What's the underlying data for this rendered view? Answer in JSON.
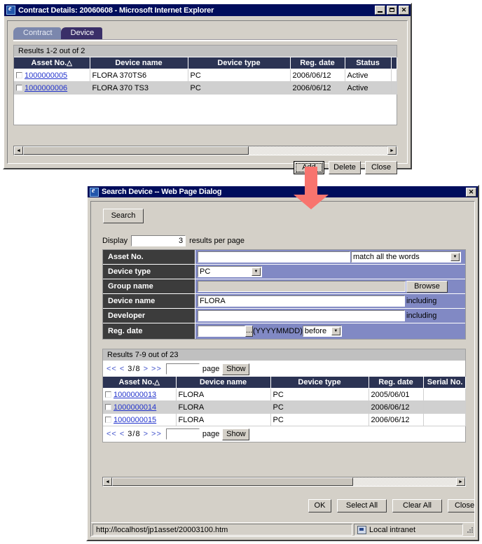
{
  "window1": {
    "title": "Contract Details: 20060608 - Microsoft Internet Explorer",
    "minimize_label": "_",
    "maximize_label": "□",
    "close_label": "×",
    "tabs": [
      {
        "label": "Contract",
        "active": false
      },
      {
        "label": "Device",
        "active": true
      }
    ],
    "results_summary": "Results 1-2 out of 2",
    "columns": [
      "Asset No.",
      "Device name",
      "Device type",
      "Reg. date",
      "Status",
      ""
    ],
    "sort_indicator": "△",
    "rows": [
      {
        "asset_no": "1000000005",
        "device_name": "FLORA 370TS6",
        "device_type": "PC",
        "reg_date": "2006/06/12",
        "status": "Active",
        "extra": ""
      },
      {
        "asset_no": "1000000006",
        "device_name": "FLORA 370 TS3",
        "device_type": "PC",
        "reg_date": "2006/06/12",
        "status": "Active",
        "extra": ""
      }
    ],
    "buttons": [
      {
        "label": "Add",
        "focused": true
      },
      {
        "label": "Delete",
        "focused": false
      },
      {
        "label": "Close",
        "focused": false
      }
    ],
    "scroll_left_arrow": "◄",
    "scroll_right_arrow": "►"
  },
  "dialog": {
    "title": "Search Device -- Web Page Dialog",
    "close_label": "×",
    "search_button": "Search",
    "display_prefix": "Display",
    "display_value": "3",
    "display_suffix": "results per page",
    "fields": [
      {
        "label": "Asset No.",
        "type": "text-with-select",
        "value": "",
        "select_value": "match all the words"
      },
      {
        "label": "Device type",
        "type": "select",
        "select_value": "PC"
      },
      {
        "label": "Group name",
        "type": "readonly-with-button",
        "value": "",
        "button_label": "Browse"
      },
      {
        "label": "Device name",
        "type": "text-with-suffix",
        "value": "FLORA",
        "suffix": "including"
      },
      {
        "label": "Developer",
        "type": "text-with-suffix",
        "value": "",
        "suffix": "including"
      },
      {
        "label": "Reg. date",
        "type": "date",
        "value": "",
        "picker_label": "...",
        "format_hint": "(YYYYMMDD)",
        "select_value": "before"
      }
    ],
    "results_summary": "Results 7-9 out of 23",
    "pager": {
      "first": "<<",
      "prev": "<",
      "position": "3/8",
      "next": ">",
      "last": ">>",
      "page_input_value": "",
      "page_label": "page",
      "show_button": "Show"
    },
    "columns": [
      "Asset No.",
      "Device name",
      "Device type",
      "Reg. date",
      "Serial No."
    ],
    "sort_indicator": "△",
    "rows": [
      {
        "asset_no": "1000000013",
        "device_name": "FLORA",
        "device_type": "PC",
        "reg_date": "2005/06/01",
        "serial_no": ""
      },
      {
        "asset_no": "1000000014",
        "device_name": "FLORA",
        "device_type": "PC",
        "reg_date": "2006/06/12",
        "serial_no": ""
      },
      {
        "asset_no": "1000000015",
        "device_name": "FLORA",
        "device_type": "PC",
        "reg_date": "2006/06/12",
        "serial_no": ""
      }
    ],
    "buttons": [
      {
        "label": "OK"
      },
      {
        "label": "Select All"
      },
      {
        "label": "Clear All"
      },
      {
        "label": "Close"
      }
    ],
    "scroll_left_arrow": "◄",
    "scroll_right_arrow": "►",
    "status_url": "http://localhost/jp1asset/20003100.htm",
    "status_zone": "Local intranet"
  },
  "annotation": {
    "arrow_color": "#f8746e",
    "arrow_direction": "down"
  }
}
